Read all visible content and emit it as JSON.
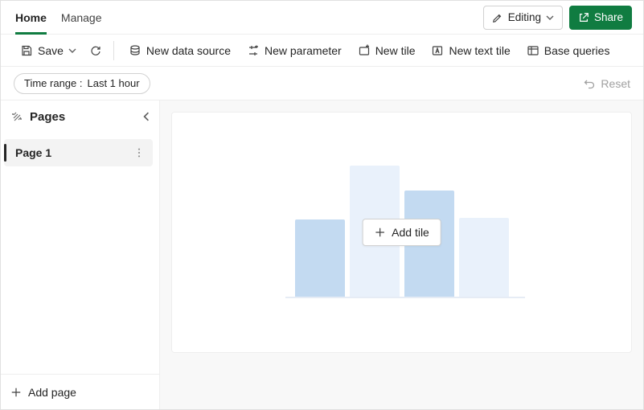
{
  "header": {
    "tabs": {
      "home": "Home",
      "manage": "Manage"
    },
    "editing_label": "Editing",
    "share_label": "Share"
  },
  "toolbar": {
    "save_label": "Save",
    "new_data_source": "New data source",
    "new_parameter": "New parameter",
    "new_tile": "New tile",
    "new_text_tile": "New text tile",
    "base_queries": "Base queries"
  },
  "filterbar": {
    "time_range_label": "Time range :",
    "time_range_value": "Last 1 hour",
    "reset": "Reset"
  },
  "sidebar": {
    "title": "Pages",
    "pages": [
      {
        "label": "Page 1"
      }
    ],
    "add_page": "Add page"
  },
  "canvas": {
    "add_tile": "Add tile"
  }
}
